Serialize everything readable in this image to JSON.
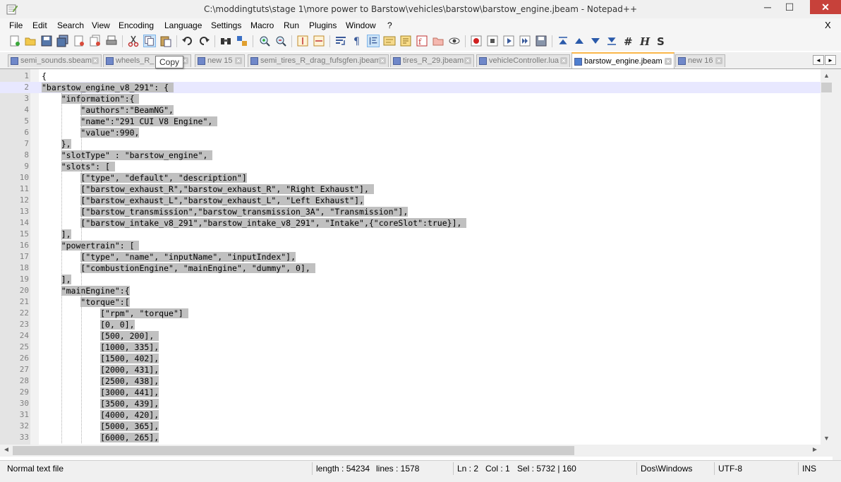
{
  "window": {
    "title": "C:\\moddingtuts\\stage 1\\more power to Barstow\\vehicles\\barstow\\barstow_engine.jbeam - Notepad++",
    "minimize": "─",
    "maximize": "☐",
    "close": "✕"
  },
  "menu": {
    "items": [
      "File",
      "Edit",
      "Search",
      "View",
      "Encoding",
      "Language",
      "Settings",
      "Macro",
      "Run",
      "Plugins",
      "Window",
      "?"
    ],
    "close_doc": "X"
  },
  "toolbar": {
    "icons": [
      "new-file-icon",
      "open-file-icon",
      "save-icon",
      "save-all-icon",
      "close-icon",
      "close-all-icon",
      "print-icon",
      "cut-icon",
      "copy-icon",
      "paste-icon",
      "undo-icon",
      "redo-icon",
      "find-icon",
      "replace-icon",
      "zoom-in-icon",
      "zoom-out-icon",
      "sync-vertical-icon",
      "sync-horizontal-icon",
      "word-wrap-icon",
      "show-all-chars-icon",
      "indent-guide-icon",
      "user-language-icon",
      "doc-map-icon",
      "function-list-icon",
      "folder-workspace-icon",
      "monitor-icon",
      "record-macro-icon",
      "stop-record-icon",
      "play-macro-icon",
      "run-macro-multiple-icon",
      "save-macro-icon",
      "fold-all-icon",
      "prev-icon",
      "next-icon",
      "unfold-all-icon",
      "hash-icon",
      "h-icon",
      "s-icon"
    ],
    "tooltip": "Copy"
  },
  "tabs": [
    {
      "label": "semi_sounds.sbeam",
      "active": false
    },
    {
      "label": "wheels_R_",
      "active": false
    },
    {
      "label": "new 15",
      "active": false
    },
    {
      "label": "semi_tires_R_drag_fufsgfen.jbeam",
      "active": false
    },
    {
      "label": "tires_R_29.jbeam",
      "active": false
    },
    {
      "label": "vehicleController.lua",
      "active": false
    },
    {
      "label": "barstow_engine.jbeam",
      "active": true
    },
    {
      "label": "new 16",
      "active": false
    }
  ],
  "tab_nav": {
    "left": "◄",
    "right": "►"
  },
  "editor": {
    "lines": [
      {
        "n": "1",
        "text": "{"
      },
      {
        "n": "2",
        "text": "\"barstow_engine_v8_291\": { "
      },
      {
        "n": "3",
        "text": "    \"information\":{ "
      },
      {
        "n": "4",
        "text": "        \"authors\":\"BeamNG\","
      },
      {
        "n": "5",
        "text": "        \"name\":\"291 CUI V8 Engine\", "
      },
      {
        "n": "6",
        "text": "        \"value\":990,"
      },
      {
        "n": "7",
        "text": "    },"
      },
      {
        "n": "8",
        "text": "    \"slotType\" : \"barstow_engine\", "
      },
      {
        "n": "9",
        "text": "    \"slots\": [ "
      },
      {
        "n": "10",
        "text": "        [\"type\", \"default\", \"description\"]"
      },
      {
        "n": "11",
        "text": "        [\"barstow_exhaust_R\",\"barstow_exhaust_R\", \"Right Exhaust\"], "
      },
      {
        "n": "12",
        "text": "        [\"barstow_exhaust_L\",\"barstow_exhaust_L\", \"Left Exhaust\"],"
      },
      {
        "n": "13",
        "text": "        [\"barstow_transmission\",\"barstow_transmission_3A\", \"Transmission\"],"
      },
      {
        "n": "14",
        "text": "        [\"barstow_intake_v8_291\",\"barstow_intake_v8_291\", \"Intake\",{\"coreSlot\":true}], "
      },
      {
        "n": "15",
        "text": "    ],"
      },
      {
        "n": "16",
        "text": "    \"powertrain\": [ "
      },
      {
        "n": "17",
        "text": "        [\"type\", \"name\", \"inputName\", \"inputIndex\"],"
      },
      {
        "n": "18",
        "text": "        [\"combustionEngine\", \"mainEngine\", \"dummy\", 0], "
      },
      {
        "n": "19",
        "text": "    ],"
      },
      {
        "n": "20",
        "text": "    \"mainEngine\":{"
      },
      {
        "n": "21",
        "text": "        \"torque\":["
      },
      {
        "n": "22",
        "text": "            [\"rpm\", \"torque\"] "
      },
      {
        "n": "23",
        "text": "            [0, 0],"
      },
      {
        "n": "24",
        "text": "            [500, 200], "
      },
      {
        "n": "25",
        "text": "            [1000, 335],"
      },
      {
        "n": "26",
        "text": "            [1500, 402],"
      },
      {
        "n": "27",
        "text": "            [2000, 431],"
      },
      {
        "n": "28",
        "text": "            [2500, 438],"
      },
      {
        "n": "29",
        "text": "            [3000, 441],"
      },
      {
        "n": "30",
        "text": "            [3500, 439],"
      },
      {
        "n": "31",
        "text": "            [4000, 420],"
      },
      {
        "n": "32",
        "text": "            [5000, 365],"
      },
      {
        "n": "33",
        "text": "            [6000, 265],"
      }
    ]
  },
  "scroll": {
    "up": "▲",
    "down": "▼",
    "left": "◄",
    "right": "►"
  },
  "status": {
    "file_type": "Normal text file",
    "length": "length : 54234",
    "lines": "lines : 1578",
    "ln": "Ln : 2",
    "col": "Col : 1",
    "sel": "Sel : 5732 | 160",
    "eol": "Dos\\Windows",
    "encoding": "UTF-8",
    "mode": "INS"
  },
  "colors": {
    "selection": "#c0c0c0",
    "current_line": "#e8e8ff",
    "active_tab_accent": "#fab74a",
    "close_button": "#c7413a"
  }
}
